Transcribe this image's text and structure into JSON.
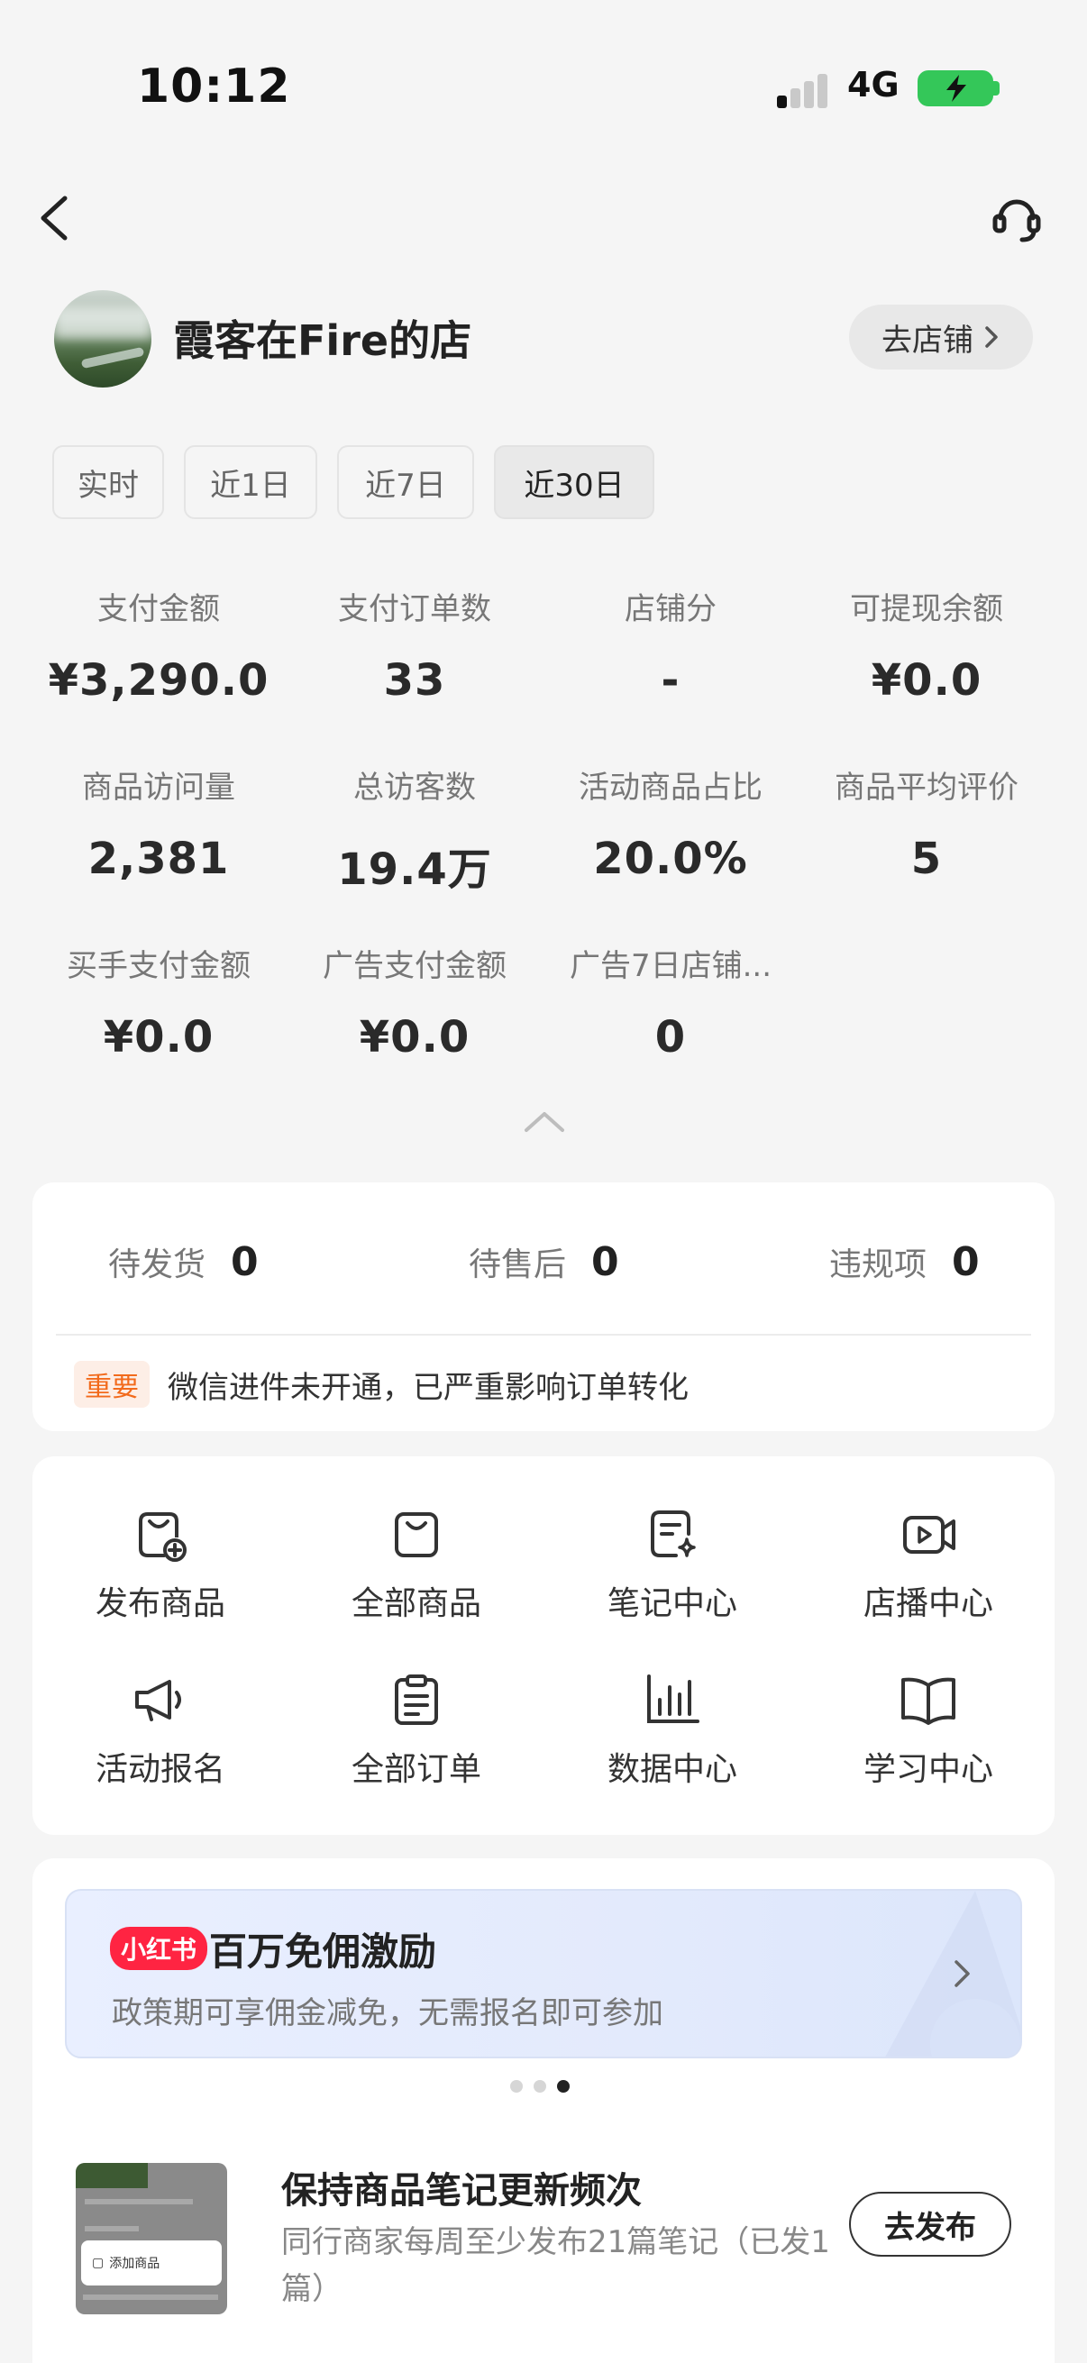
{
  "status_bar": {
    "time": "10:12",
    "network": "4G"
  },
  "store": {
    "name": "霞客在Fire的店",
    "go_store_label": "去店铺"
  },
  "period_tabs": [
    {
      "label": "实时",
      "active": false
    },
    {
      "label": "近1日",
      "active": false
    },
    {
      "label": "近7日",
      "active": false
    },
    {
      "label": "近30日",
      "active": true
    }
  ],
  "stats": [
    {
      "label": "支付金额",
      "value": "¥3,290.0"
    },
    {
      "label": "支付订单数",
      "value": "33"
    },
    {
      "label": "店铺分",
      "value": "-"
    },
    {
      "label": "可提现余额",
      "value": "¥0.0"
    },
    {
      "label": "商品访问量",
      "value": "2,381"
    },
    {
      "label": "总访客数",
      "value": "19.4万"
    },
    {
      "label": "活动商品占比",
      "value": "20.0%"
    },
    {
      "label": "商品平均评价",
      "value": "5"
    },
    {
      "label": "买手支付金额",
      "value": "¥0.0"
    },
    {
      "label": "广告支付金额",
      "value": "¥0.0"
    },
    {
      "label": "广告7日店铺...",
      "value": "0"
    }
  ],
  "todos": [
    {
      "label": "待发货",
      "count": "0"
    },
    {
      "label": "待售后",
      "count": "0"
    },
    {
      "label": "违规项",
      "count": "0"
    }
  ],
  "notice": {
    "badge": "重要",
    "text": "微信进件未开通，已严重影响订单转化"
  },
  "quick_actions": [
    {
      "label": "发布商品",
      "icon": "publish-product-icon"
    },
    {
      "label": "全部商品",
      "icon": "bag-icon"
    },
    {
      "label": "笔记中心",
      "icon": "note-sparkle-icon"
    },
    {
      "label": "店播中心",
      "icon": "live-camera-icon"
    },
    {
      "label": "活动报名",
      "icon": "megaphone-icon"
    },
    {
      "label": "全部订单",
      "icon": "clipboard-icon"
    },
    {
      "label": "数据中心",
      "icon": "bar-chart-icon"
    },
    {
      "label": "学习中心",
      "icon": "book-icon"
    }
  ],
  "banner": {
    "brand": "小红书",
    "title": "百万免佣激励",
    "subtitle": "政策期可享佣金减免，无需报名即可参加"
  },
  "task": {
    "thumb_button": "添加商品",
    "title": "保持商品笔记更新频次",
    "description": "同行商家每周至少发布21篇笔记（已发1篇）",
    "action_label": "去发布"
  },
  "colors": {
    "accent_red": "#ff2442",
    "important_orange": "#f26a1b",
    "battery_green": "#34c759"
  }
}
